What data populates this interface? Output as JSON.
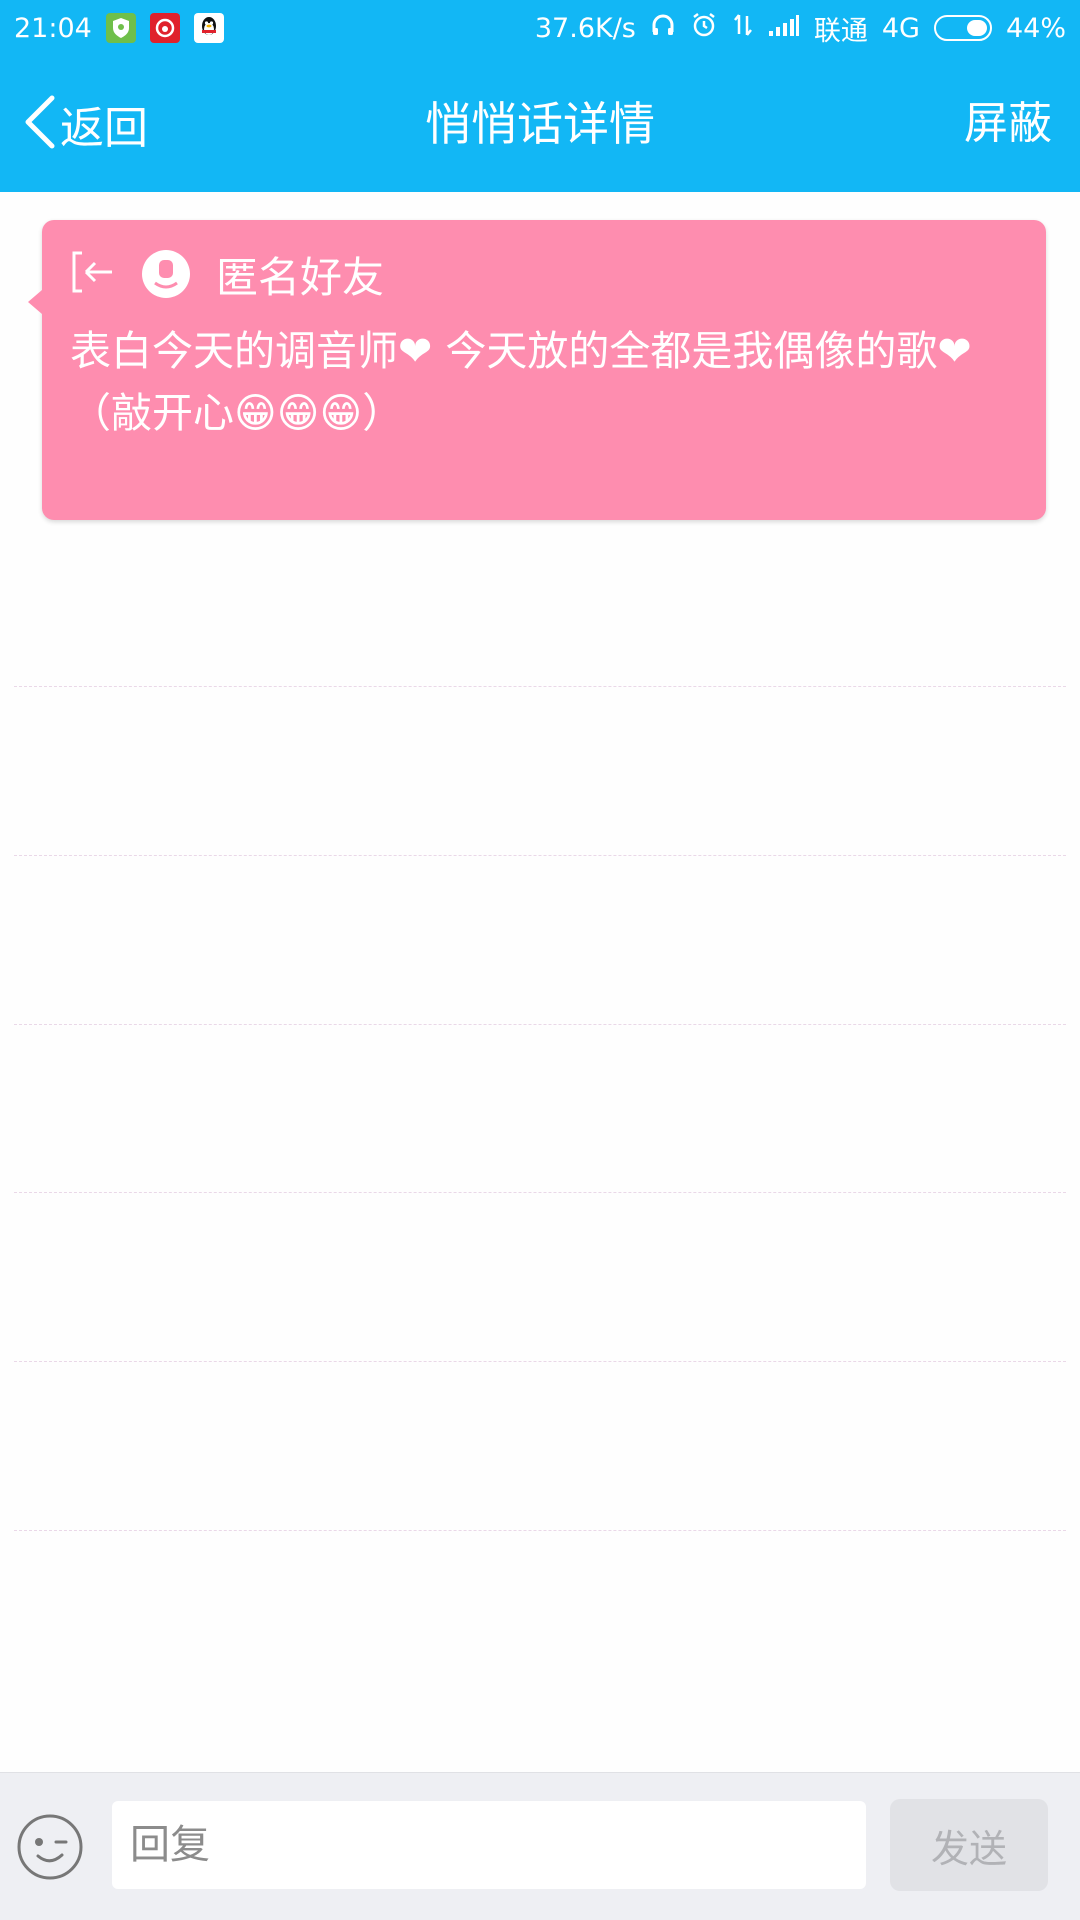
{
  "status_bar": {
    "time": "21:04",
    "network_speed": "37.6K/s",
    "carrier": "联通",
    "network_type": "4G",
    "battery": "44%",
    "battery_level": 0.44,
    "icons": [
      "shield-app-icon",
      "netease-music-icon",
      "qq-penguin-icon",
      "headphones-icon",
      "alarm-icon",
      "data-arrows-icon",
      "signal-icon",
      "battery-icon"
    ]
  },
  "header": {
    "back_label": "返回",
    "title": "悄悄话详情",
    "action_label": "屏蔽"
  },
  "note": {
    "sender": "匿名好友",
    "message": "表白今天的调音师❤ 今天放的全都是我偶像的歌❤ （敲开心😁😁😁）",
    "background_color": "#fe8daf"
  },
  "reply_bar": {
    "input_placeholder": "回复",
    "send_label": "发送"
  },
  "colors": {
    "accent": "#12b7f5",
    "note_pink": "#fe8daf"
  }
}
